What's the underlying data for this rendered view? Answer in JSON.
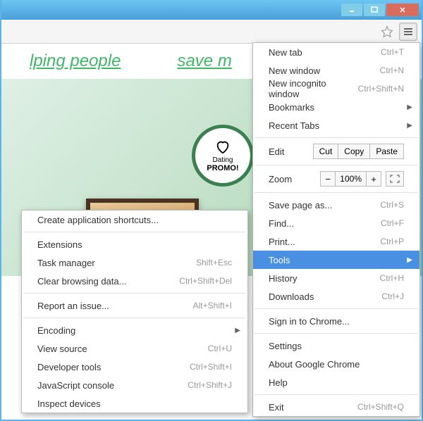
{
  "page": {
    "banner_text_1": "lping people",
    "banner_text_2": "save m",
    "promo_small": "Dating",
    "promo_big": "PROMO!"
  },
  "main_menu": {
    "new_tab": {
      "label": "New tab",
      "shortcut": "Ctrl+T"
    },
    "new_window": {
      "label": "New window",
      "shortcut": "Ctrl+N"
    },
    "new_incognito": {
      "label": "New incognito window",
      "shortcut": "Ctrl+Shift+N"
    },
    "bookmarks": {
      "label": "Bookmarks"
    },
    "recent_tabs": {
      "label": "Recent Tabs"
    },
    "edit": {
      "label": "Edit",
      "cut": "Cut",
      "copy": "Copy",
      "paste": "Paste"
    },
    "zoom": {
      "label": "Zoom",
      "value": "100%"
    },
    "save_page": {
      "label": "Save page as...",
      "shortcut": "Ctrl+S"
    },
    "find": {
      "label": "Find...",
      "shortcut": "Ctrl+F"
    },
    "print": {
      "label": "Print...",
      "shortcut": "Ctrl+P"
    },
    "tools": {
      "label": "Tools"
    },
    "history": {
      "label": "History",
      "shortcut": "Ctrl+H"
    },
    "downloads": {
      "label": "Downloads",
      "shortcut": "Ctrl+J"
    },
    "signin": {
      "label": "Sign in to Chrome..."
    },
    "settings": {
      "label": "Settings"
    },
    "about": {
      "label": "About Google Chrome"
    },
    "help": {
      "label": "Help"
    },
    "exit": {
      "label": "Exit",
      "shortcut": "Ctrl+Shift+Q"
    }
  },
  "sub_menu": {
    "create_app": {
      "label": "Create application shortcuts..."
    },
    "extensions": {
      "label": "Extensions"
    },
    "task_manager": {
      "label": "Task manager",
      "shortcut": "Shift+Esc"
    },
    "clear_data": {
      "label": "Clear browsing data...",
      "shortcut": "Ctrl+Shift+Del"
    },
    "report": {
      "label": "Report an issue...",
      "shortcut": "Alt+Shift+I"
    },
    "encoding": {
      "label": "Encoding"
    },
    "view_source": {
      "label": "View source",
      "shortcut": "Ctrl+U"
    },
    "dev_tools": {
      "label": "Developer tools",
      "shortcut": "Ctrl+Shift+I"
    },
    "js_console": {
      "label": "JavaScript console",
      "shortcut": "Ctrl+Shift+J"
    },
    "inspect": {
      "label": "Inspect devices"
    }
  }
}
